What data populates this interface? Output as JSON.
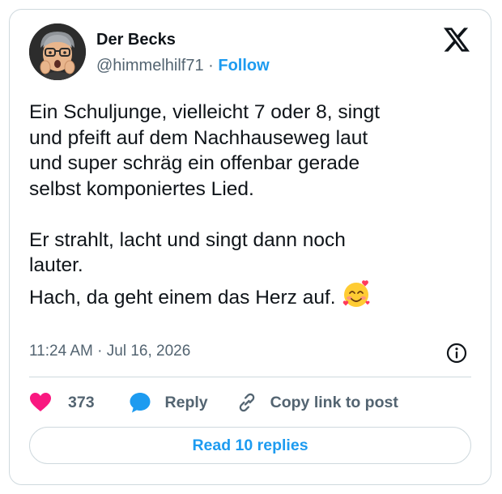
{
  "tweet": {
    "author_name": "Der Becks",
    "handle": "@himmelhilf71",
    "separator": "·",
    "follow_label": "Follow",
    "text": "Ein Schuljunge, vielleicht 7 oder 8, singt\nund pfeift auf dem Nachhauseweg laut\nund super schräg ein offenbar gerade\nselbst komponiertes Lied.\n\nEr strahlt, lacht und singt dann noch\nlauter.\nHach, da geht einem das Herz auf.",
    "emoji_icon": "smiling-face-with-hearts-icon",
    "timestamp": "11:24 AM · Jul 16, 2026"
  },
  "actions": {
    "like_count": "373",
    "reply_label": "Reply",
    "copy_link_label": "Copy link to post"
  },
  "footer": {
    "read_replies_label": "Read 10 replies"
  },
  "colors": {
    "accent": "#1d9bf0",
    "like": "#f91880",
    "secondary_text": "#536471",
    "border": "#cfd9de"
  }
}
